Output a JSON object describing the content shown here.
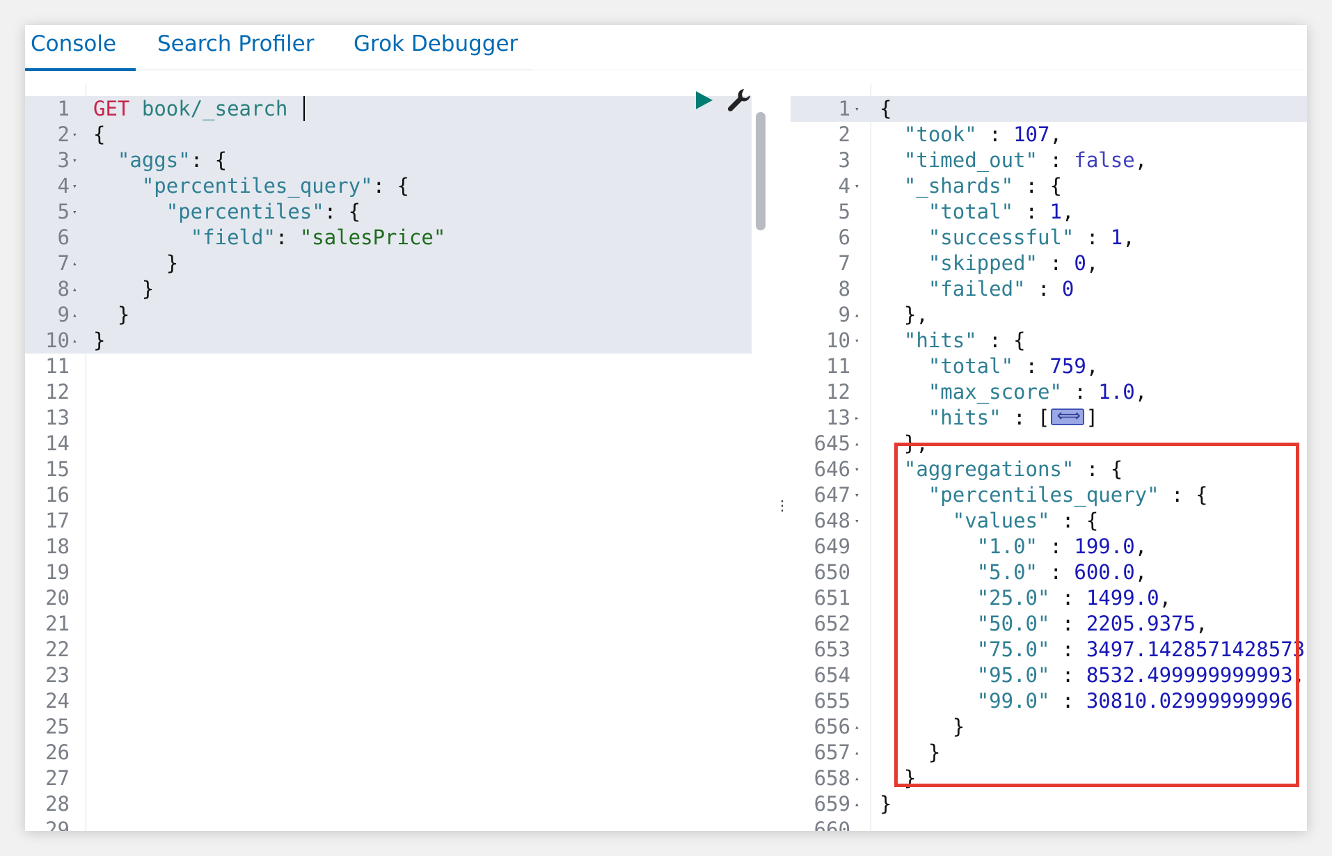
{
  "tabs": [
    {
      "label": "Console",
      "active": true
    },
    {
      "label": "Search Profiler",
      "active": false
    },
    {
      "label": "Grok Debugger",
      "active": false
    }
  ],
  "icons": {
    "run": "play-triangle-icon",
    "settings": "wrench-icon",
    "split": "vertical-ellipsis-icon"
  },
  "colors": {
    "accent": "#006bb4",
    "highlight_box": "#e53a2f",
    "run_icon": "#017d73"
  },
  "editor": {
    "request_method": "GET",
    "request_path": "book/_search",
    "line_count": 29,
    "lines": [
      {
        "n": "1",
        "fold": "",
        "tokens": [
          [
            "t-method",
            "GET"
          ],
          [
            "t-punc",
            " "
          ],
          [
            "t-url",
            "book/_search"
          ]
        ]
      },
      {
        "n": "2",
        "fold": "▾",
        "tokens": [
          [
            "t-punc",
            "{"
          ]
        ]
      },
      {
        "n": "3",
        "fold": "▾",
        "tokens": [
          [
            "t-punc",
            "  "
          ],
          [
            "t-key",
            "\"aggs\""
          ],
          [
            "t-punc",
            ": {"
          ]
        ]
      },
      {
        "n": "4",
        "fold": "▾",
        "tokens": [
          [
            "t-punc",
            "    "
          ],
          [
            "t-key",
            "\"percentiles_query\""
          ],
          [
            "t-punc",
            ": {"
          ]
        ]
      },
      {
        "n": "5",
        "fold": "▾",
        "tokens": [
          [
            "t-punc",
            "      "
          ],
          [
            "t-key",
            "\"percentiles\""
          ],
          [
            "t-punc",
            ": {"
          ]
        ]
      },
      {
        "n": "6",
        "fold": "",
        "tokens": [
          [
            "t-punc",
            "        "
          ],
          [
            "t-key",
            "\"field\""
          ],
          [
            "t-punc",
            ": "
          ],
          [
            "t-str",
            "\"salesPrice\""
          ]
        ]
      },
      {
        "n": "7",
        "fold": "▴",
        "tokens": [
          [
            "t-punc",
            "      }"
          ]
        ]
      },
      {
        "n": "8",
        "fold": "▴",
        "tokens": [
          [
            "t-punc",
            "    }"
          ]
        ]
      },
      {
        "n": "9",
        "fold": "▴",
        "tokens": [
          [
            "t-punc",
            "  }"
          ]
        ]
      },
      {
        "n": "10",
        "fold": "▴",
        "tokens": [
          [
            "t-punc",
            "}"
          ]
        ]
      },
      {
        "n": "11",
        "fold": "",
        "tokens": []
      },
      {
        "n": "12",
        "fold": "",
        "tokens": []
      },
      {
        "n": "13",
        "fold": "",
        "tokens": []
      },
      {
        "n": "14",
        "fold": "",
        "tokens": []
      },
      {
        "n": "15",
        "fold": "",
        "tokens": []
      },
      {
        "n": "16",
        "fold": "",
        "tokens": []
      },
      {
        "n": "17",
        "fold": "",
        "tokens": []
      },
      {
        "n": "18",
        "fold": "",
        "tokens": []
      },
      {
        "n": "19",
        "fold": "",
        "tokens": []
      },
      {
        "n": "20",
        "fold": "",
        "tokens": []
      },
      {
        "n": "21",
        "fold": "",
        "tokens": []
      },
      {
        "n": "22",
        "fold": "",
        "tokens": []
      },
      {
        "n": "23",
        "fold": "",
        "tokens": []
      },
      {
        "n": "24",
        "fold": "",
        "tokens": []
      },
      {
        "n": "25",
        "fold": "",
        "tokens": []
      },
      {
        "n": "26",
        "fold": "",
        "tokens": []
      },
      {
        "n": "27",
        "fold": "",
        "tokens": []
      },
      {
        "n": "28",
        "fold": "",
        "tokens": []
      },
      {
        "n": "29",
        "fold": "",
        "tokens": []
      }
    ]
  },
  "output": {
    "lines": [
      {
        "n": "1",
        "fold": "▾",
        "tokens": [
          [
            "t-punc",
            "{"
          ]
        ]
      },
      {
        "n": "2",
        "fold": "",
        "tokens": [
          [
            "t-punc",
            "  "
          ],
          [
            "t-key",
            "\"took\""
          ],
          [
            "t-punc",
            " : "
          ],
          [
            "t-num",
            "107"
          ],
          [
            "t-punc",
            ","
          ]
        ]
      },
      {
        "n": "3",
        "fold": "",
        "tokens": [
          [
            "t-punc",
            "  "
          ],
          [
            "t-key",
            "\"timed_out\""
          ],
          [
            "t-punc",
            " : "
          ],
          [
            "t-bool",
            "false"
          ],
          [
            "t-punc",
            ","
          ]
        ]
      },
      {
        "n": "4",
        "fold": "▾",
        "tokens": [
          [
            "t-punc",
            "  "
          ],
          [
            "t-key",
            "\"_shards\""
          ],
          [
            "t-punc",
            " : {"
          ]
        ]
      },
      {
        "n": "5",
        "fold": "",
        "tokens": [
          [
            "t-punc",
            "    "
          ],
          [
            "t-key",
            "\"total\""
          ],
          [
            "t-punc",
            " : "
          ],
          [
            "t-num",
            "1"
          ],
          [
            "t-punc",
            ","
          ]
        ]
      },
      {
        "n": "6",
        "fold": "",
        "tokens": [
          [
            "t-punc",
            "    "
          ],
          [
            "t-key",
            "\"successful\""
          ],
          [
            "t-punc",
            " : "
          ],
          [
            "t-num",
            "1"
          ],
          [
            "t-punc",
            ","
          ]
        ]
      },
      {
        "n": "7",
        "fold": "",
        "tokens": [
          [
            "t-punc",
            "    "
          ],
          [
            "t-key",
            "\"skipped\""
          ],
          [
            "t-punc",
            " : "
          ],
          [
            "t-num",
            "0"
          ],
          [
            "t-punc",
            ","
          ]
        ]
      },
      {
        "n": "8",
        "fold": "",
        "tokens": [
          [
            "t-punc",
            "    "
          ],
          [
            "t-key",
            "\"failed\""
          ],
          [
            "t-punc",
            " : "
          ],
          [
            "t-num",
            "0"
          ]
        ]
      },
      {
        "n": "9",
        "fold": "▴",
        "tokens": [
          [
            "t-punc",
            "  },"
          ]
        ]
      },
      {
        "n": "10",
        "fold": "▾",
        "tokens": [
          [
            "t-punc",
            "  "
          ],
          [
            "t-key",
            "\"hits\""
          ],
          [
            "t-punc",
            " : {"
          ]
        ]
      },
      {
        "n": "11",
        "fold": "",
        "tokens": [
          [
            "t-punc",
            "    "
          ],
          [
            "t-key",
            "\"total\""
          ],
          [
            "t-punc",
            " : "
          ],
          [
            "t-num",
            "759"
          ],
          [
            "t-punc",
            ","
          ]
        ]
      },
      {
        "n": "12",
        "fold": "",
        "tokens": [
          [
            "t-punc",
            "    "
          ],
          [
            "t-key",
            "\"max_score\""
          ],
          [
            "t-punc",
            " : "
          ],
          [
            "t-num",
            "1.0"
          ],
          [
            "t-punc",
            ","
          ]
        ]
      },
      {
        "n": "13",
        "fold": "▸",
        "tokens": [
          [
            "t-punc",
            "    "
          ],
          [
            "t-key",
            "\"hits\""
          ],
          [
            "t-punc",
            " : ["
          ],
          [
            "badge",
            ""
          ],
          [
            "t-punc",
            "]"
          ]
        ]
      },
      {
        "n": "645",
        "fold": "▴",
        "tokens": [
          [
            "t-punc",
            "  },"
          ]
        ]
      },
      {
        "n": "646",
        "fold": "▾",
        "tokens": [
          [
            "t-punc",
            "  "
          ],
          [
            "t-key",
            "\"aggregations\""
          ],
          [
            "t-punc",
            " : {"
          ]
        ]
      },
      {
        "n": "647",
        "fold": "▾",
        "tokens": [
          [
            "t-punc",
            "    "
          ],
          [
            "t-key",
            "\"percentiles_query\""
          ],
          [
            "t-punc",
            " : {"
          ]
        ]
      },
      {
        "n": "648",
        "fold": "▾",
        "tokens": [
          [
            "t-punc",
            "      "
          ],
          [
            "t-key",
            "\"values\""
          ],
          [
            "t-punc",
            " : {"
          ]
        ]
      },
      {
        "n": "649",
        "fold": "",
        "tokens": [
          [
            "t-punc",
            "        "
          ],
          [
            "t-key",
            "\"1.0\""
          ],
          [
            "t-punc",
            " : "
          ],
          [
            "t-num",
            "199.0"
          ],
          [
            "t-punc",
            ","
          ]
        ]
      },
      {
        "n": "650",
        "fold": "",
        "tokens": [
          [
            "t-punc",
            "        "
          ],
          [
            "t-key",
            "\"5.0\""
          ],
          [
            "t-punc",
            " : "
          ],
          [
            "t-num",
            "600.0"
          ],
          [
            "t-punc",
            ","
          ]
        ]
      },
      {
        "n": "651",
        "fold": "",
        "tokens": [
          [
            "t-punc",
            "        "
          ],
          [
            "t-key",
            "\"25.0\""
          ],
          [
            "t-punc",
            " : "
          ],
          [
            "t-num",
            "1499.0"
          ],
          [
            "t-punc",
            ","
          ]
        ]
      },
      {
        "n": "652",
        "fold": "",
        "tokens": [
          [
            "t-punc",
            "        "
          ],
          [
            "t-key",
            "\"50.0\""
          ],
          [
            "t-punc",
            " : "
          ],
          [
            "t-num",
            "2205.9375"
          ],
          [
            "t-punc",
            ","
          ]
        ]
      },
      {
        "n": "653",
        "fold": "",
        "tokens": [
          [
            "t-punc",
            "        "
          ],
          [
            "t-key",
            "\"75.0\""
          ],
          [
            "t-punc",
            " : "
          ],
          [
            "t-num",
            "3497.1428571428573"
          ],
          [
            "t-punc",
            ","
          ]
        ]
      },
      {
        "n": "654",
        "fold": "",
        "tokens": [
          [
            "t-punc",
            "        "
          ],
          [
            "t-key",
            "\"95.0\""
          ],
          [
            "t-punc",
            " : "
          ],
          [
            "t-num",
            "8532.499999999993"
          ],
          [
            "t-punc",
            ","
          ]
        ]
      },
      {
        "n": "655",
        "fold": "",
        "tokens": [
          [
            "t-punc",
            "        "
          ],
          [
            "t-key",
            "\"99.0\""
          ],
          [
            "t-punc",
            " : "
          ],
          [
            "t-num",
            "30810.02999999996"
          ]
        ]
      },
      {
        "n": "656",
        "fold": "▴",
        "tokens": [
          [
            "t-punc",
            "      }"
          ]
        ]
      },
      {
        "n": "657",
        "fold": "▴",
        "tokens": [
          [
            "t-punc",
            "    }"
          ]
        ]
      },
      {
        "n": "658",
        "fold": "▴",
        "tokens": [
          [
            "t-punc",
            "  }"
          ]
        ]
      },
      {
        "n": "659",
        "fold": "▴",
        "tokens": [
          [
            "t-punc",
            "}"
          ]
        ]
      },
      {
        "n": "660",
        "fold": "",
        "tokens": []
      }
    ]
  }
}
